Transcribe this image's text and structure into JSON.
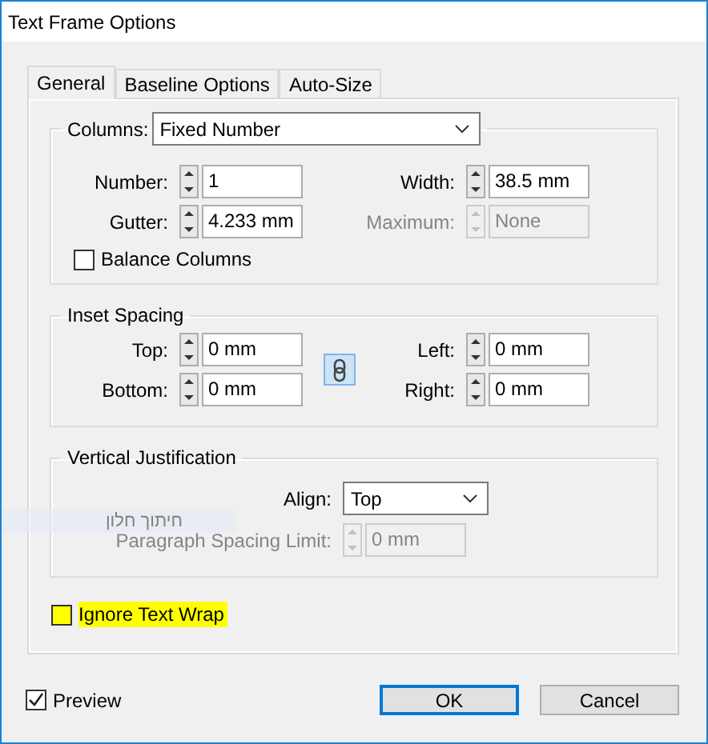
{
  "window": {
    "title": "Text Frame Options"
  },
  "tabs": [
    {
      "label": "General",
      "selected": true
    },
    {
      "label": "Baseline Options",
      "selected": false
    },
    {
      "label": "Auto-Size",
      "selected": false
    }
  ],
  "columns": {
    "label": "Columns:",
    "value": "Fixed Number",
    "fields": [
      {
        "label": "Number:",
        "value": "1",
        "disabled": false
      },
      {
        "label": "Width:",
        "value": "38.5 mm",
        "disabled": false
      },
      {
        "label": "Gutter:",
        "value": "4.233 mm",
        "disabled": false
      },
      {
        "label": "Maximum:",
        "value": "None",
        "disabled": true
      }
    ],
    "balance": {
      "label": "Balance Columns",
      "checked": false
    }
  },
  "inset_spacing": {
    "title": "Inset Spacing",
    "fields": [
      {
        "label": "Top:",
        "value": "0 mm",
        "disabled": false
      },
      {
        "label": "Left:",
        "value": "0 mm",
        "disabled": false
      },
      {
        "label": "Bottom:",
        "value": "0 mm",
        "disabled": false
      },
      {
        "label": "Right:",
        "value": "0 mm",
        "disabled": false
      }
    ],
    "link": {
      "selected": true
    }
  },
  "vertical_justification": {
    "title": "Vertical Justification",
    "align": {
      "label": "Align:",
      "value": "Top"
    },
    "spacing_limit": {
      "label": "Paragraph Spacing Limit:",
      "value": "0 mm",
      "disabled": true
    }
  },
  "ignore_text_wrap": {
    "label": "Ignore Text Wrap",
    "checked": false,
    "highlighted": true
  },
  "overlay_label": "חיתוך חלון",
  "preview": {
    "label": "Preview",
    "checked": true
  },
  "buttons": [
    {
      "label": "OK",
      "default": true
    },
    {
      "label": "Cancel",
      "default": false
    }
  ]
}
